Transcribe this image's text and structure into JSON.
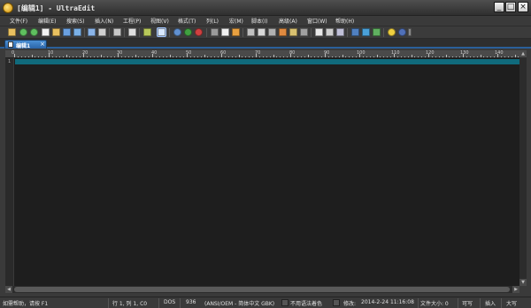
{
  "window": {
    "title": "[编辑1] - UltraEdit"
  },
  "menu": [
    "文件(F)",
    "编辑(E)",
    "搜索(S)",
    "插入(N)",
    "工程(P)",
    "视图(V)",
    "格式(T)",
    "列(L)",
    "宏(M)",
    "脚本(I)",
    "高级(A)",
    "窗口(W)",
    "帮助(H)"
  ],
  "tab": {
    "label": "编辑1",
    "close": "×"
  },
  "ruler": {
    "numbers": [
      "0",
      "10",
      "20",
      "30",
      "40",
      "50",
      "60",
      "70",
      "80",
      "90",
      "100",
      "110",
      "120",
      "130",
      "140"
    ]
  },
  "editor": {
    "line_numbers": [
      "1"
    ]
  },
  "status": {
    "help": "如需帮助，请按 F1",
    "position": "行 1, 列 1, C0",
    "line_ending": "DOS",
    "codepage": "936",
    "encoding": "(ANSI/OEM - 简体中文 GBK)",
    "highlight": "不用语法着色",
    "modified": "修改:",
    "datetime": "2014-2-24 11:16:08",
    "filesize": "文件大小: 0",
    "writable": "可写",
    "insert": "插入",
    "caps": "大写"
  },
  "colors": {
    "editor_bg": "#1e1e1e",
    "current_line": "#106a7c",
    "tab_active": "#2a64a8"
  }
}
